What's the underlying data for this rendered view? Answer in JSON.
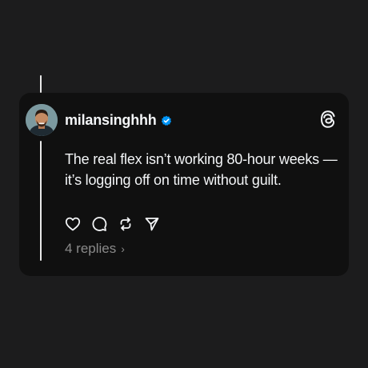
{
  "post": {
    "username": "milansinghhh",
    "text": "The real flex isn’t working 80-hour weeks — it’s logging off on time without guilt.",
    "replies_label": "4 replies",
    "replies_chevron": "›"
  },
  "icons": {
    "verified": "verified-badge-icon",
    "logo": "threads-logo-icon",
    "like": "heart-icon",
    "comment": "comment-icon",
    "repost": "repost-icon",
    "share": "send-icon"
  },
  "colors": {
    "background": "#1c1c1d",
    "card": "#101010",
    "text": "#f3f5f7",
    "muted": "#8a8a8a",
    "verified": "#0095f6"
  }
}
